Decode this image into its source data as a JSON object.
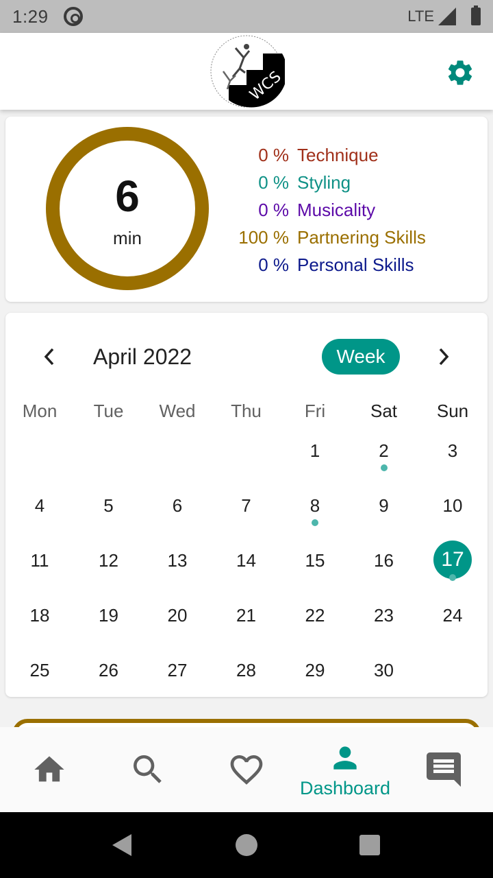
{
  "status_bar": {
    "time": "1:29",
    "network": "LTE"
  },
  "app_bar": {
    "logo_text": "WCS"
  },
  "summary": {
    "minutes": "6",
    "unit": "min",
    "ring_color": "#9a6f00",
    "categories": [
      {
        "pct": "0 %",
        "label": "Technique",
        "color": "#a0301a"
      },
      {
        "pct": "0 %",
        "label": "Styling",
        "color": "#0f9186"
      },
      {
        "pct": "0 %",
        "label": "Musicality",
        "color": "#5c0aa8"
      },
      {
        "pct": "100 %",
        "label": "Partnering Skills",
        "color": "#9a6f00"
      },
      {
        "pct": "0 %",
        "label": "Personal Skills",
        "color": "#0d1a8c"
      }
    ]
  },
  "calendar": {
    "month_label": "April 2022",
    "view_button": "Week",
    "accent": "#009688",
    "weekdays": [
      "Mon",
      "Tue",
      "Wed",
      "Thu",
      "Fri",
      "Sat",
      "Sun"
    ],
    "first_weekday_index": 4,
    "days_in_month": 30,
    "selected_day": 17,
    "days_with_dots": [
      2,
      8,
      17
    ]
  },
  "bottom_nav": {
    "items": [
      {
        "icon": "home-icon",
        "label": ""
      },
      {
        "icon": "search-icon",
        "label": ""
      },
      {
        "icon": "heart-icon",
        "label": ""
      },
      {
        "icon": "person-icon",
        "label": "Dashboard",
        "active": true
      },
      {
        "icon": "chat-icon",
        "label": ""
      }
    ]
  }
}
